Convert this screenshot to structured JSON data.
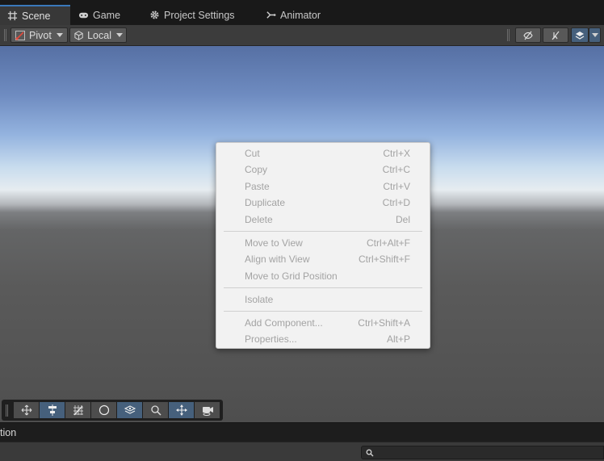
{
  "tabs": [
    {
      "label": "Scene",
      "icon": "grid-icon",
      "active": true
    },
    {
      "label": "Game",
      "icon": "gamepad-icon",
      "active": false
    },
    {
      "label": "Project Settings",
      "icon": "gear-icon",
      "active": false
    },
    {
      "label": "Animator",
      "icon": "animator-icon",
      "active": false
    }
  ],
  "toolbar": {
    "pivot_label": "Pivot",
    "local_label": "Local",
    "right_buttons": [
      "scene-visibility-icon",
      "scene-picking-icon",
      "layers-icon"
    ]
  },
  "context_menu": {
    "items": [
      {
        "label": "Cut",
        "shortcut": "Ctrl+X"
      },
      {
        "label": "Copy",
        "shortcut": "Ctrl+C"
      },
      {
        "label": "Paste",
        "shortcut": "Ctrl+V"
      },
      {
        "label": "Duplicate",
        "shortcut": "Ctrl+D"
      },
      {
        "label": "Delete",
        "shortcut": "Del"
      },
      {
        "label": "Move to View",
        "shortcut": "Ctrl+Alt+F"
      },
      {
        "label": "Align with View",
        "shortcut": "Ctrl+Shift+F"
      },
      {
        "label": "Move to Grid Position",
        "shortcut": ""
      },
      {
        "label": "Isolate",
        "shortcut": ""
      },
      {
        "label": "Add Component...",
        "shortcut": "Ctrl+Shift+A"
      },
      {
        "label": "Properties...",
        "shortcut": "Alt+P"
      }
    ]
  },
  "overlay_tools": [
    {
      "icon": "move-tool-icon",
      "active": false
    },
    {
      "icon": "align-tool-icon",
      "active": true
    },
    {
      "icon": "grid-snap-icon",
      "active": false
    },
    {
      "icon": "moon-icon",
      "active": false
    },
    {
      "icon": "layers-snap-icon",
      "active": true
    },
    {
      "icon": "magnifier-icon",
      "active": false
    },
    {
      "icon": "gizmo-move-icon",
      "active": true
    },
    {
      "icon": "camera-icon",
      "active": false
    }
  ],
  "bottom_panel": {
    "title_fragment": "tion",
    "search_placeholder": ""
  },
  "colors": {
    "accent": "#3a79bb",
    "active_button": "#46607c",
    "menu_bg": "#f2f2f2",
    "menu_text_disabled": "#a3a3a3"
  }
}
